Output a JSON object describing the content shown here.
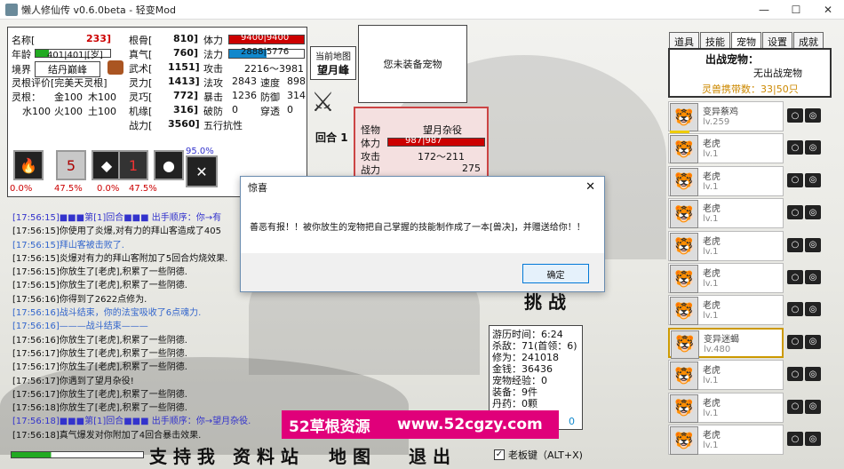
{
  "window": {
    "title": "懒人修仙传 v0.6.0beta - 轻变Mod",
    "min": "—",
    "max": "☐",
    "close": "✕"
  },
  "char": {
    "name_label": "名称[",
    "name": "233]",
    "age_label": "年龄",
    "age": "401|401|[岁]",
    "realm_label": "境界",
    "realm": "结丹巅峰",
    "root_eval_label": "灵根评价",
    "root_eval": "[完美天灵根]",
    "root_label": "灵根：",
    "metal": "金100",
    "wood": "木100",
    "water": "水100",
    "fire": "火100",
    "earth": "土100",
    "genggu_label": "根骨[",
    "genggu": "810]",
    "zhenqi_label": "真气[",
    "zhenqi": "760]",
    "wuyi_label": "武术[",
    "wuyi": "1151]",
    "lingli_label": "灵力[",
    "lingli": "1413]",
    "lingqiao_label": "灵巧[",
    "lingqiao": "772]",
    "jiyuan_label": "机缘[",
    "jiyuan": "316]",
    "zhanli_label": "战力[",
    "zhanli": "3560]",
    "hp_label": "体力",
    "hp": "9400|9400",
    "mp_label": "法力",
    "mp": "2888|5776",
    "atk_label": "攻击",
    "atk": "2216～3981",
    "matk_label": "法攻",
    "matk": "2843",
    "speed_label": "速度",
    "speed": "898",
    "crit_label": "暴击",
    "crit": "1236",
    "def_label": "防御",
    "def": "314",
    "break_label": "破防",
    "break": "0",
    "pierce_label": "穿透",
    "pierce": "0",
    "elem_label": "五行",
    "elem": "抗性"
  },
  "skills": {
    "p1": "0.0%",
    "p2": "47.5%",
    "p3": "0.0%",
    "p4": "47.5%",
    "p5": "95.0%",
    "s2": "5",
    "s3": "1"
  },
  "map": {
    "label": "当前地图",
    "name": "望月峰"
  },
  "pet_box": {
    "empty": "您未装备宠物"
  },
  "enemy": {
    "label": "怪物",
    "name": "望月杂役",
    "hp_label": "体力",
    "hp": "987|987",
    "atk_label": "攻击",
    "atk": "172～211",
    "pow_label": "战力",
    "pow": "275"
  },
  "round": {
    "label": "回合",
    "value": "1"
  },
  "right": {
    "tabs": [
      "道具",
      "技能",
      "宠物",
      "设置",
      "成就"
    ],
    "out_label": "出战宠物：",
    "out_value": "无出战宠物",
    "carry_label": "灵兽携带数：",
    "carry_value": "33|50只",
    "pets": [
      {
        "name": "变异蔡鸡",
        "lv": "lv.259"
      },
      {
        "name": "老虎",
        "lv": "lv.1"
      },
      {
        "name": "老虎",
        "lv": "lv.1"
      },
      {
        "name": "老虎",
        "lv": "lv.1"
      },
      {
        "name": "老虎",
        "lv": "lv.1"
      },
      {
        "name": "老虎",
        "lv": "lv.1"
      },
      {
        "name": "老虎",
        "lv": "lv.1"
      },
      {
        "name": "变异迷蝎",
        "lv": "lv.480"
      },
      {
        "name": "老虎",
        "lv": "lv.1"
      },
      {
        "name": "老虎",
        "lv": "lv.1"
      },
      {
        "name": "老虎",
        "lv": "lv.1"
      }
    ]
  },
  "log": [
    {
      "t": "[17:56:15]",
      "m": "■■■第[1]回合■■■ 出手顺序：你→有"
    },
    {
      "t": "[17:56:15]",
      "m": "你使用了炎爆,对有力的拜山客造成了405"
    },
    {
      "t": "[17:56:15]",
      "m": "拜山客被击败了."
    },
    {
      "t": "[17:56:15]",
      "m": "炎爆对有力的拜山客附加了5回合灼烧效果."
    },
    {
      "t": "[17:56:15]",
      "m": "你放生了[老虎],积累了一些阴德."
    },
    {
      "t": "[17:56:15]",
      "m": "你放生了[老虎],积累了一些阴德."
    },
    {
      "t": "[17:56:16]",
      "m": "你得到了2622点修为."
    },
    {
      "t": "[17:56:16]",
      "m": "战斗结束，你的法宝吸收了6点魂力."
    },
    {
      "t": "[17:56:16]",
      "m": "———战斗结束———"
    },
    {
      "t": "[17:56:16]",
      "m": "你放生了[老虎],积累了一些阴德."
    },
    {
      "t": "[17:56:17]",
      "m": "你放生了[老虎],积累了一些阴德."
    },
    {
      "t": "[17:56:17]",
      "m": "你放生了[老虎],积累了一些阴德."
    },
    {
      "t": "[17:56:17]",
      "m": "你遇到了望月杂役!"
    },
    {
      "t": "[17:56:17]",
      "m": "你放生了[老虎],积累了一些阴德."
    },
    {
      "t": "[17:56:18]",
      "m": "你放生了[老虎],积累了一些阴德."
    },
    {
      "t": "[17:56:18]",
      "m": "■■■第[1]回合■■■ 出手顺序：你→望月杂役."
    },
    {
      "t": "[17:56:18]",
      "m": "真气爆发对你附加了4回合暴击效果."
    }
  ],
  "stats": {
    "l1": "游历时间：6:24",
    "l2": "杀敌：71(首领：6)",
    "l3": "修为：241018",
    "l4": "金钱：36436",
    "l5": "宠物经验：0",
    "l6": "装备：9件",
    "l7": "丹药：0颗",
    "l8": "0"
  },
  "buttons": {
    "challenge": "挑 战",
    "support": "支 持 我",
    "data": "资 料 站",
    "map": "地 图",
    "exit": "退 出",
    "boss_key": "老板键（ALT+X)"
  },
  "dialog": {
    "title": "惊喜",
    "message": "善恶有报！！被你放生的宠物把自己掌握的技能制作成了一本[兽决]，并赠送给你！！",
    "ok": "确定",
    "close": "✕"
  },
  "watermark": {
    "left": "52草根资源",
    "right": "www.52cgzy.com"
  }
}
